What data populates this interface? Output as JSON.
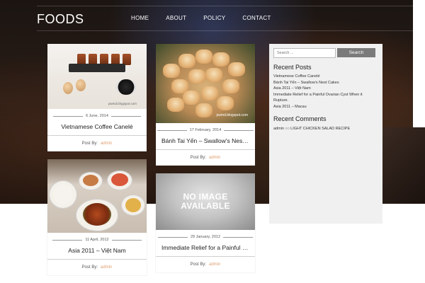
{
  "site": {
    "logo": "FOODS"
  },
  "nav": [
    "HOME",
    "ABOUT",
    "POLICY",
    "CONTACT"
  ],
  "posts": [
    {
      "date": "6 June, 2014",
      "title": "Vietnamese Coffee Canelé",
      "post_by": "Post By:",
      "author": "admin",
      "watermark": "pwmd.blogspot.com"
    },
    {
      "date": "17 February, 2014",
      "title": "Bánh Tai Yến – Swallow's Nest ...",
      "post_by": "Post By:",
      "author": "admin",
      "watermark": "pwmd.blogspot.com"
    },
    {
      "date": "11 April, 2012",
      "title": "Asia 2011 – Việt Nam",
      "post_by": "Post By:",
      "author": "admin"
    },
    {
      "date": "29 January, 2012",
      "title": "Immediate Relief for a Painful Ov...",
      "post_by": "Post By:",
      "author": "admin",
      "placeholder": "NO IMAGE AVAILABLE"
    }
  ],
  "sidebar": {
    "search_placeholder": "Search ...",
    "search_button": "Search",
    "recent_posts_heading": "Recent Posts",
    "recent_posts": [
      "Vietnamese Coffee Canelé",
      "Bánh Tai Yến – Swallow's Nest Cakes",
      "Asia 2011 – Việt Nam",
      "Immediate Relief for a Painful Ovarian Cyst When it Rupture.",
      "Asia 2011 – Macau"
    ],
    "recent_comments_heading": "Recent Comments",
    "comment": {
      "author": "admin",
      "on": "on",
      "post": "LIGHT CHICKEN SALAD RECIPE"
    }
  },
  "colors": {
    "author_link": "#e0a070",
    "search_button": "#7a7a7a"
  }
}
